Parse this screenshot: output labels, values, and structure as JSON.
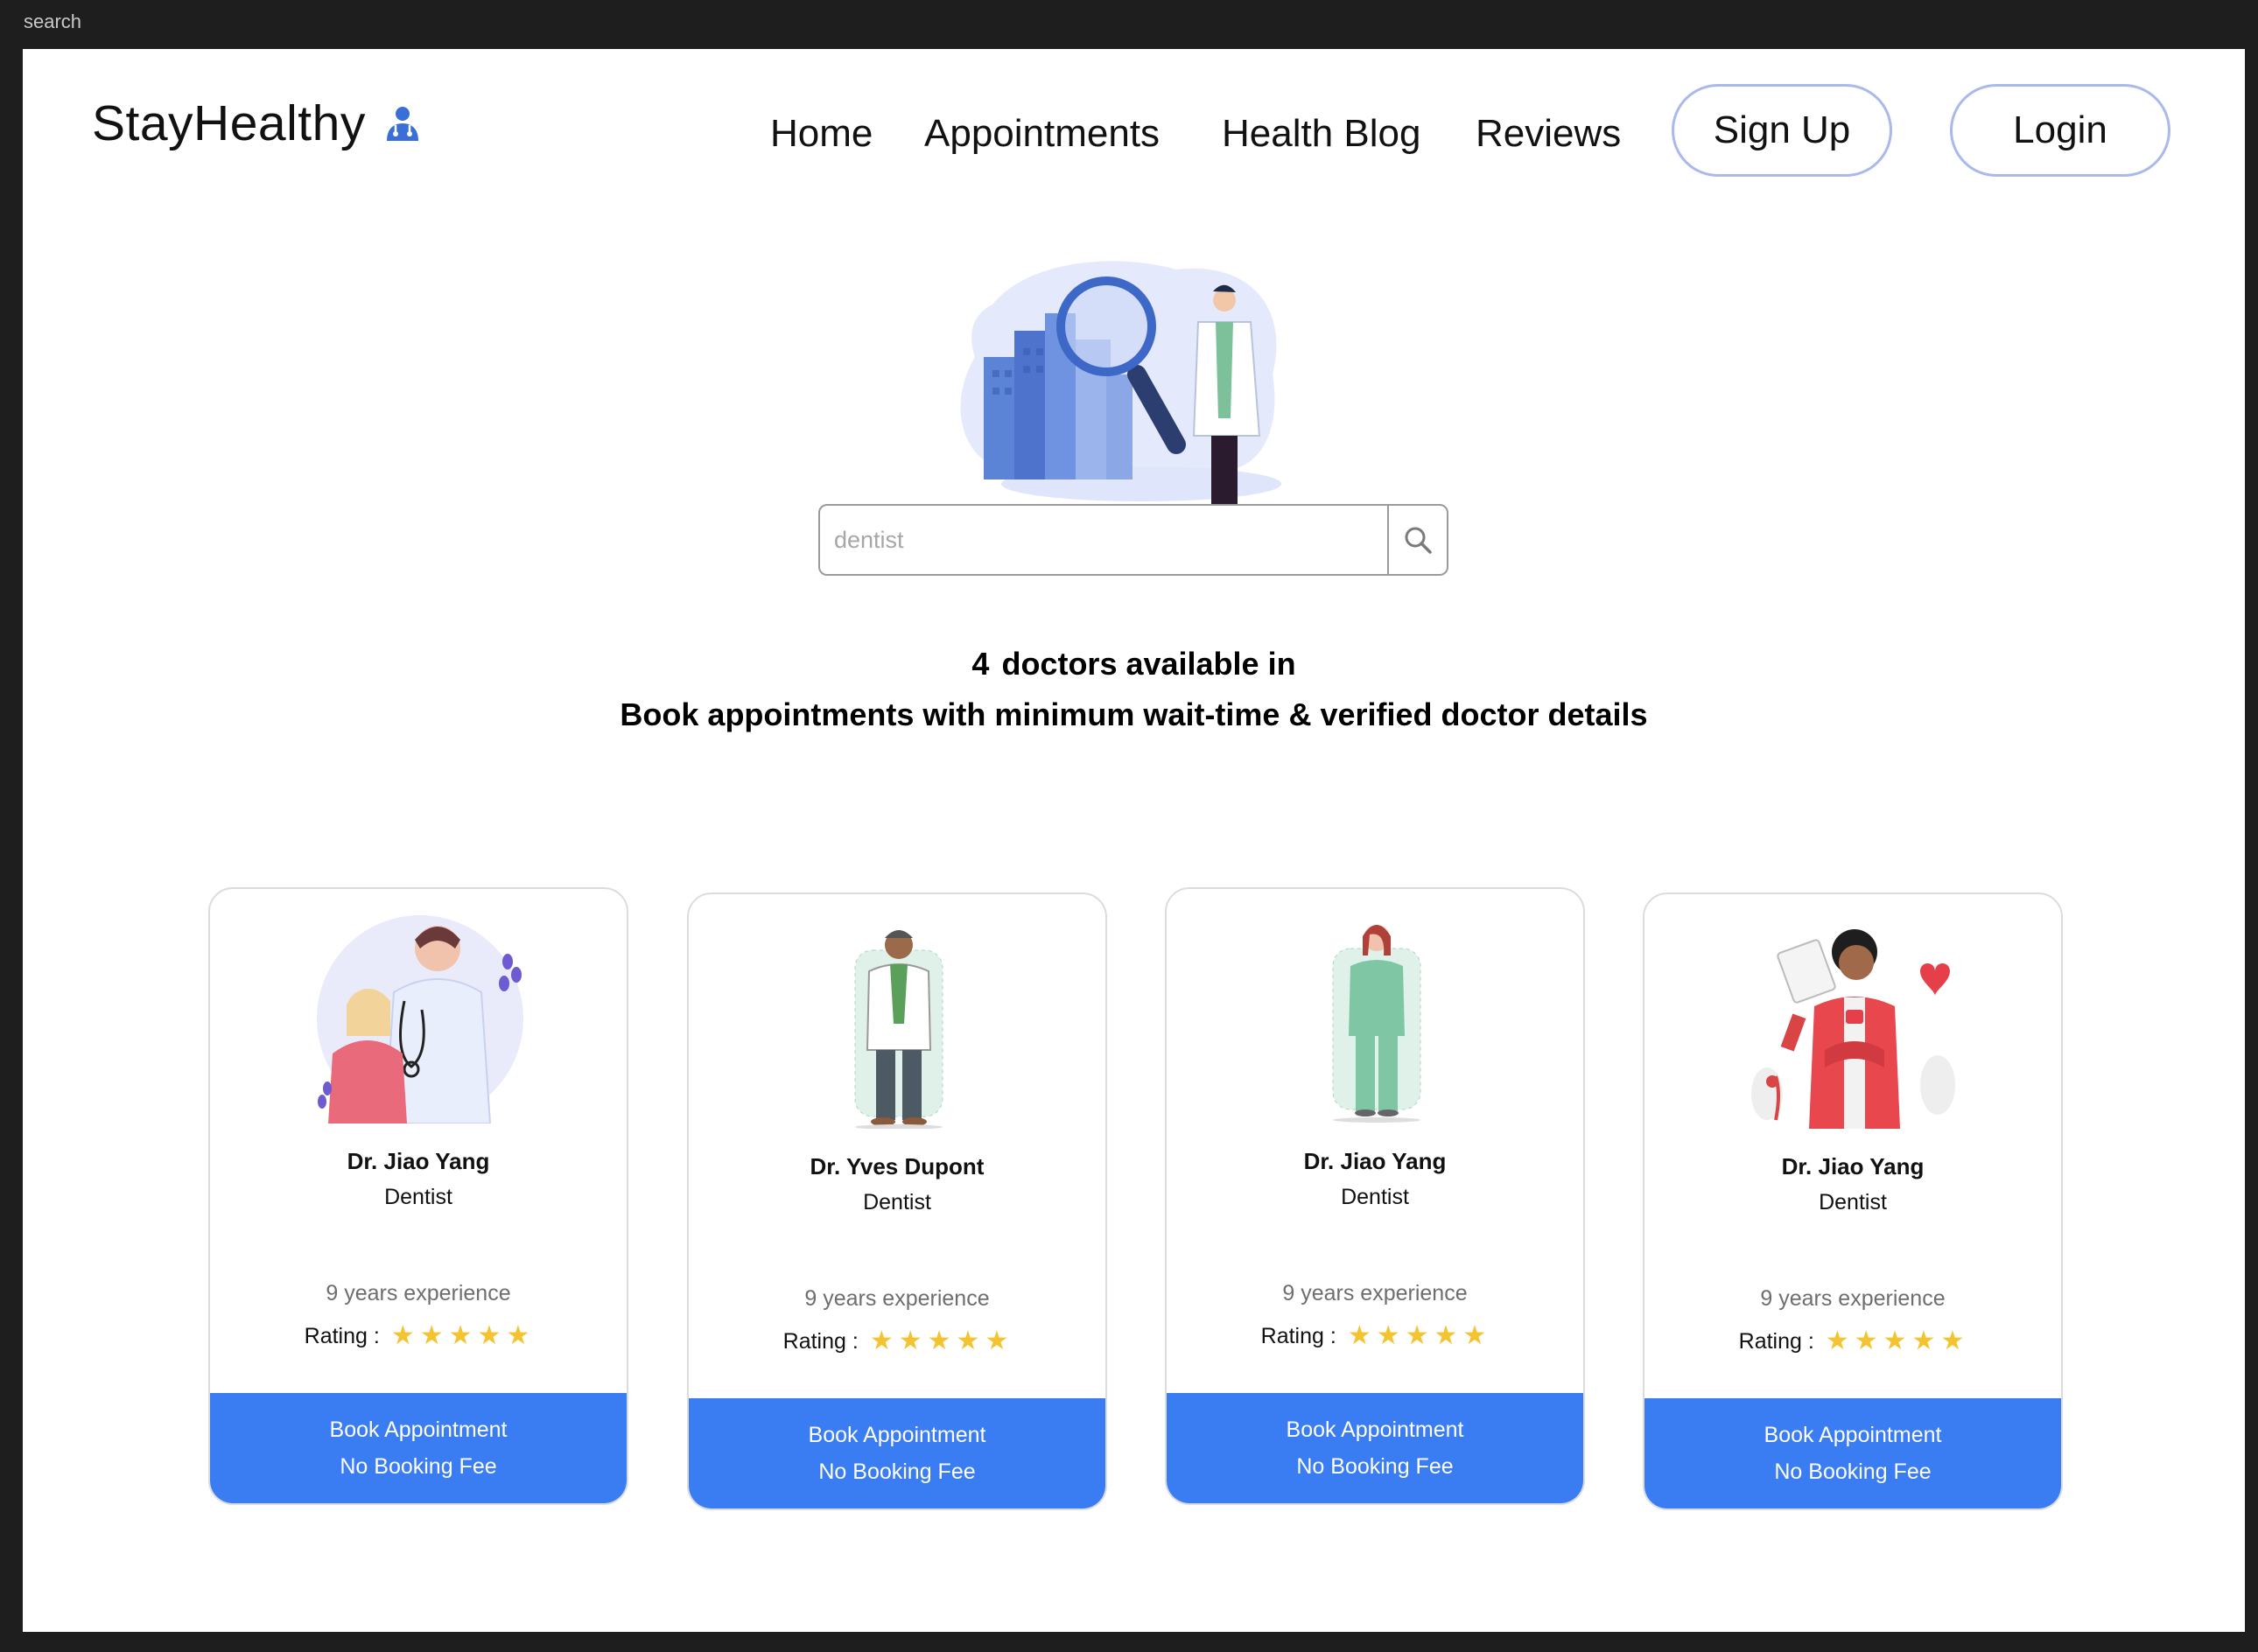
{
  "window": {
    "title": "search"
  },
  "brand": {
    "name": "StayHealthy",
    "icon": "doctor-icon"
  },
  "nav": {
    "links": [
      "Home",
      "Appointments",
      "Health Blog",
      "Reviews"
    ],
    "signup_label": "Sign Up",
    "login_label": "Login"
  },
  "search": {
    "value": "",
    "placeholder": "dentist",
    "icon": "magnifier-icon"
  },
  "results": {
    "count": "4",
    "count_text": "doctors available in",
    "tagline": "Book appointments with minimum wait-time & verified doctor details"
  },
  "doctors": [
    {
      "name": "Dr. Jiao Yang",
      "speciality": "Dentist",
      "experience": "9 years experience",
      "rating_label": "Rating :",
      "rating": 5,
      "book_label": "Book Appointment",
      "fee_label": "No Booking Fee"
    },
    {
      "name": "Dr. Yves Dupont",
      "speciality": "Dentist",
      "experience": "9 years experience",
      "rating_label": "Rating :",
      "rating": 5,
      "book_label": "Book Appointment",
      "fee_label": "No Booking Fee"
    },
    {
      "name": "Dr. Jiao Yang",
      "speciality": "Dentist",
      "experience": "9 years experience",
      "rating_label": "Rating :",
      "rating": 5,
      "book_label": "Book Appointment",
      "fee_label": "No Booking Fee"
    },
    {
      "name": "Dr. Jiao Yang",
      "speciality": "Dentist",
      "experience": "9 years experience",
      "rating_label": "Rating :",
      "rating": 5,
      "book_label": "Book Appointment",
      "fee_label": "No Booking Fee"
    }
  ],
  "colors": {
    "accent": "#3a7cf2",
    "button_border": "#a9b9ee",
    "star": "#f3c430"
  }
}
